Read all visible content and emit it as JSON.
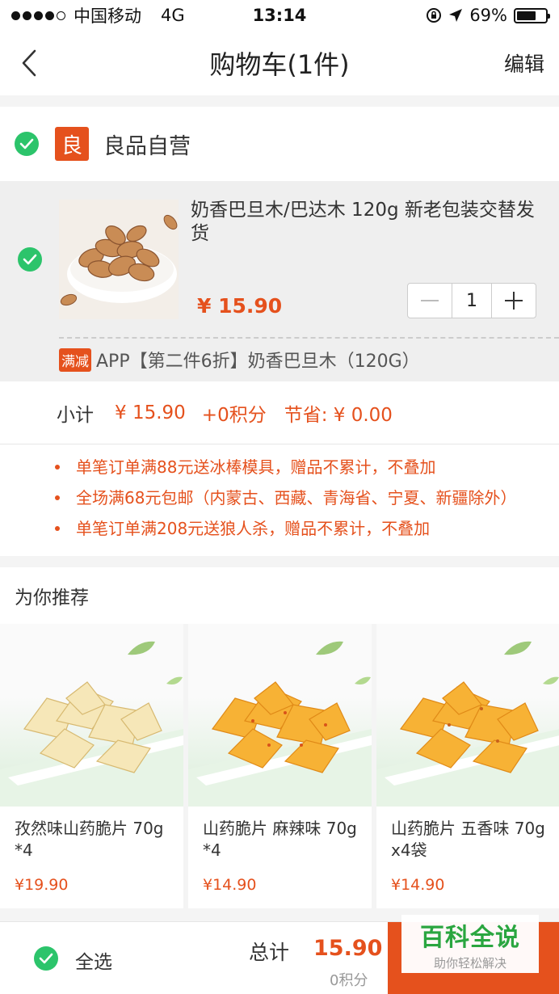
{
  "status_bar": {
    "carrier": "中国移动",
    "network": "4G",
    "time": "13:14",
    "battery_percent": "69%",
    "battery_level": 0.69
  },
  "nav": {
    "title": "购物车(1件)",
    "edit_label": "编辑"
  },
  "shop": {
    "badge": "良",
    "name": "良品自营"
  },
  "cart_item": {
    "name": "奶香巴旦木/巴达木 120g  新老包装交替发货",
    "price": "¥ 15.90",
    "quantity": "1",
    "promo_tag": "满减",
    "promo_text": "APP【第二件6折】奶香巴旦木（120G）"
  },
  "subtotal": {
    "label": "小计",
    "price": "¥ 15.90",
    "points": "+0积分",
    "savings": "节省: ¥ 0.00"
  },
  "notices": [
    "单笔订单满88元送冰棒模具，赠品不累计，不叠加",
    "全场满68元包邮（内蒙古、西藏、青海省、宁夏、新疆除外）",
    "单笔订单满208元送狼人杀，赠品不累计，不叠加"
  ],
  "recommend": {
    "title": "为你推荐",
    "items": [
      {
        "name": "孜然味山药脆片 70g*4",
        "price": "¥19.90"
      },
      {
        "name": "山药脆片 麻辣味 70g*4",
        "price": "¥14.90"
      },
      {
        "name": "山药脆片 五香味 70gx4袋",
        "price": "¥14.90"
      }
    ]
  },
  "bottom": {
    "select_all": "全选",
    "total_label": "总计",
    "total_value": "15.90",
    "total_points": "0积分"
  },
  "watermark": {
    "main": "百科全说",
    "sub": "助你轻松解决"
  },
  "colors": {
    "accent": "#e5511d",
    "check_green": "#2cc46b",
    "watermark_green": "#2aa640"
  }
}
